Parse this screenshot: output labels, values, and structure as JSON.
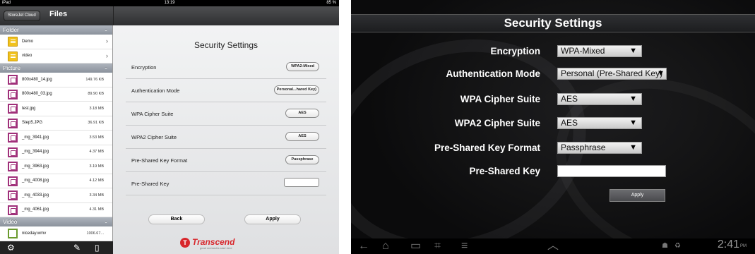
{
  "ipad": {
    "status": {
      "device": "iPad",
      "time": "13:19",
      "battery": "85 %"
    },
    "cloud_button": "StoreJet Cloud",
    "files_title": "Files",
    "sections": [
      {
        "title": "Folder",
        "items": [
          {
            "name": "Demo",
            "size": ""
          },
          {
            "name": "video",
            "size": ""
          }
        ]
      },
      {
        "title": "Picture",
        "items": [
          {
            "name": "800x480_14.jpg",
            "size": "149.76 KB"
          },
          {
            "name": "800x480_03.jpg",
            "size": "89.90 KB"
          },
          {
            "name": "test.jpg",
            "size": "3.18 MB"
          },
          {
            "name": "Step5.JPG",
            "size": "36.91 KB"
          },
          {
            "name": "_mg_3941.jpg",
            "size": "3.53 MB"
          },
          {
            "name": "_mg_3944.jpg",
            "size": "4.37 MB"
          },
          {
            "name": "_mg_3963.jpg",
            "size": "3.19 MB"
          },
          {
            "name": "_mg_4008.jpg",
            "size": "4.12 MB"
          },
          {
            "name": "_mg_4033.jpg",
            "size": "3.34 MB"
          },
          {
            "name": "_mg_4061.jpg",
            "size": "4.31 MB"
          }
        ]
      },
      {
        "title": "Video",
        "items": [
          {
            "name": "niceday.wmv",
            "size": "1006.67..."
          }
        ]
      }
    ],
    "settings": {
      "title": "Security Settings",
      "rows": [
        {
          "label": "Encryption",
          "value": "WPA2-Mixed"
        },
        {
          "label": "Authentication Mode",
          "value": "Personal...hared Key)"
        },
        {
          "label": "WPA Cipher Suite",
          "value": "AES"
        },
        {
          "label": "WPA2 Cipher Suite",
          "value": "AES"
        },
        {
          "label": "Pre-Shared Key Format",
          "value": "Passphrase"
        },
        {
          "label": "Pre-Shared Key",
          "value": ""
        }
      ],
      "back_label": "Back",
      "apply_label": "Apply"
    },
    "brand": {
      "name": "Transcend",
      "tagline": "good memories start here"
    }
  },
  "android": {
    "title": "Security Settings",
    "rows": [
      {
        "label": "Encryption",
        "value": "WPA-Mixed"
      },
      {
        "label": "Authentication Mode",
        "value": "Personal (Pre-Shared Key)"
      },
      {
        "label": "WPA Cipher Suite",
        "value": "AES"
      },
      {
        "label": "WPA2 Cipher Suite",
        "value": "AES"
      },
      {
        "label": "Pre-Shared Key Format",
        "value": "Passphrase"
      },
      {
        "label": "Pre-Shared Key",
        "value": ""
      }
    ],
    "apply_label": "Apply",
    "clock": "2:41",
    "ampm": "PM"
  }
}
